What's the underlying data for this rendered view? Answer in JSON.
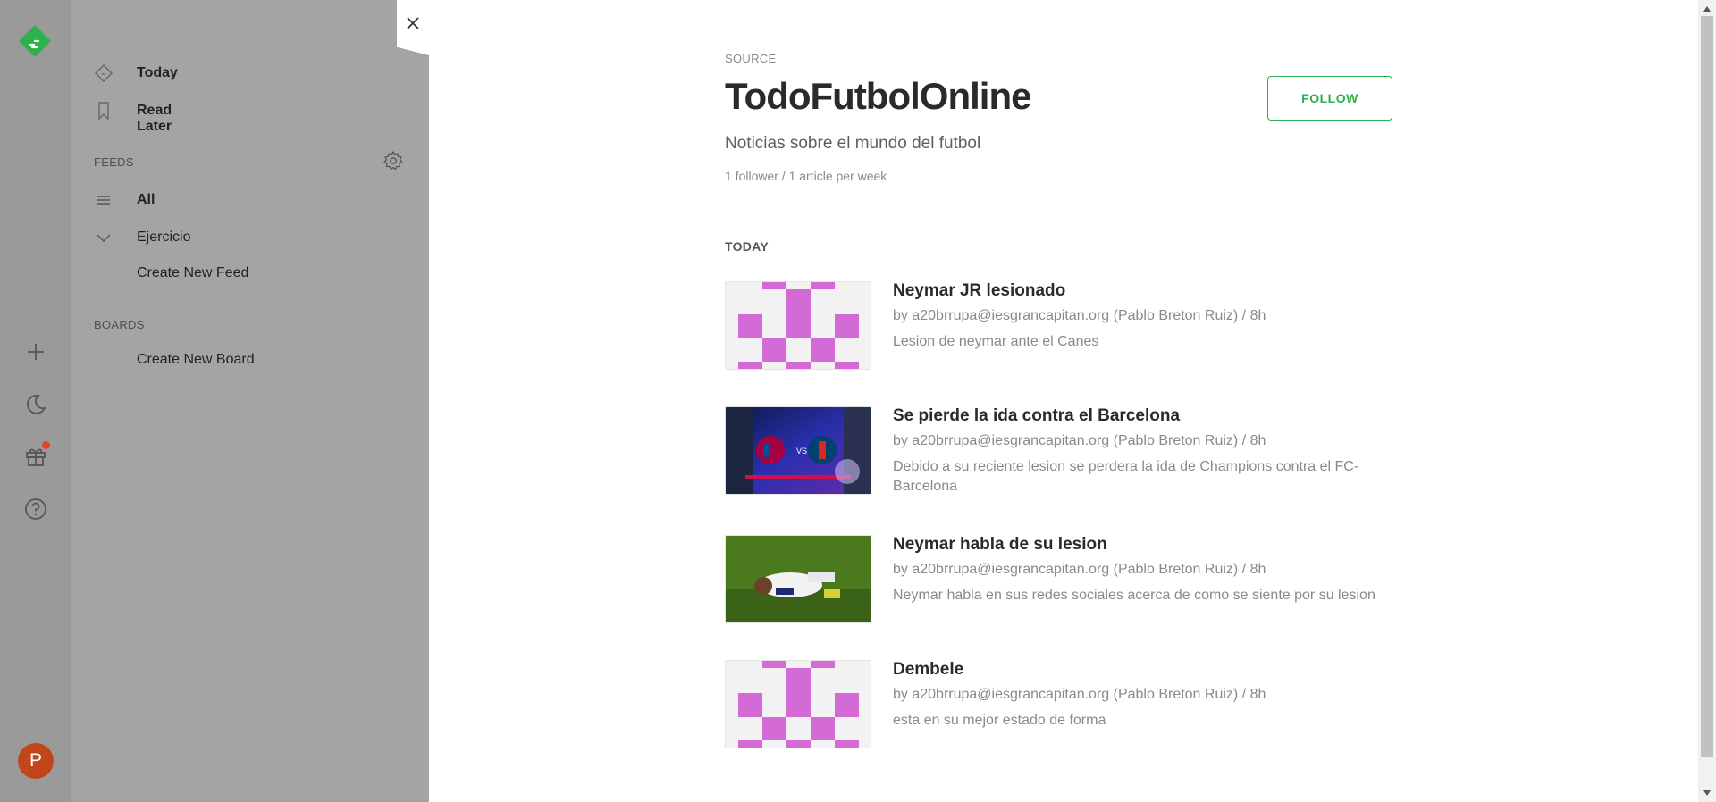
{
  "rail": {
    "avatar_letter": "P",
    "icons": [
      "feedly-logo-icon",
      "plus-icon",
      "moon-icon",
      "gift-icon",
      "help-icon"
    ],
    "brand_color": "#2bb24c",
    "avatar_color": "#c1461c"
  },
  "nav": {
    "today_label": "Today",
    "read_later_label": "Read Later",
    "feeds_section": "FEEDS",
    "all_label": "All",
    "folder_label": "Ejercicio",
    "create_feed_label": "Create New Feed",
    "boards_section": "BOARDS",
    "create_board_label": "Create New Board"
  },
  "source": {
    "label": "SOURCE",
    "title": "TodoFutbolOnline",
    "follow_label": "FOLLOW",
    "description": "Noticias sobre el mundo del futbol",
    "stats": "1 follower / 1 article per week"
  },
  "section_today": "TODAY",
  "articles": [
    {
      "title": "Neymar JR lesionado",
      "meta": "by a20brrupa@iesgrancapitan.org (Pablo Breton Ruiz) / 8h",
      "summary": "Lesion de neymar ante el Canes"
    },
    {
      "title": "Se pierde la ida contra el Barcelona",
      "meta": "by a20brrupa@iesgrancapitan.org (Pablo Breton Ruiz) / 8h",
      "summary": "Debido a su reciente lesion se perdera la ida de Champions contra el FC-Barcelona"
    },
    {
      "title": "Neymar habla de su lesion",
      "meta": "by a20brrupa@iesgrancapitan.org (Pablo Breton Ruiz) / 8h",
      "summary": "Neymar habla en sus redes sociales acerca de como se siente por su lesion"
    },
    {
      "title": "Dembele",
      "meta": "by a20brrupa@iesgrancapitan.org (Pablo Breton Ruiz) / 8h",
      "summary": "esta en su mejor estado de forma"
    }
  ]
}
